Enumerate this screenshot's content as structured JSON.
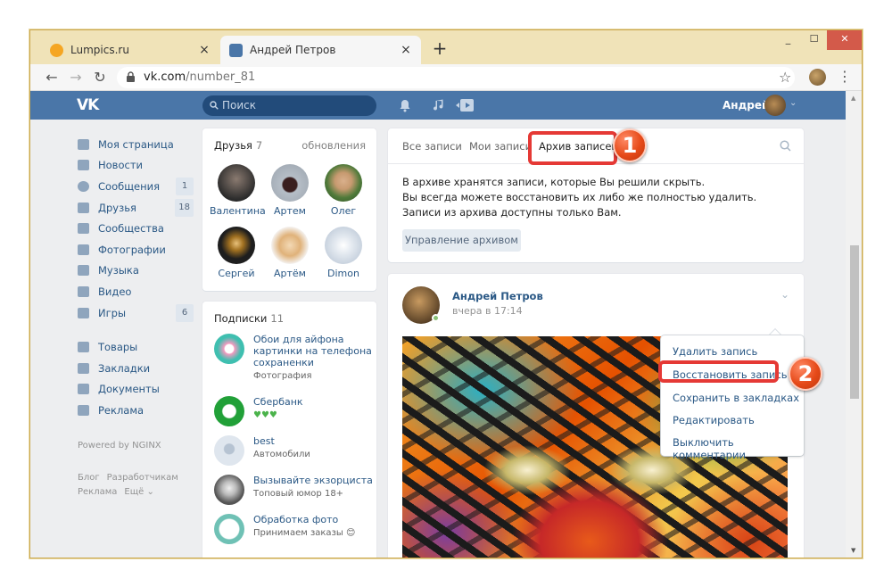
{
  "browser": {
    "tabs": [
      {
        "title": "Lumpics.ru",
        "fav_color": "#f5a623"
      },
      {
        "title": "Андрей Петров",
        "fav_color": "#4a76a8"
      }
    ],
    "tab_close": "×",
    "new_tab": "+",
    "url_host": "vk.com",
    "url_path": "/number_81",
    "win_min": "_",
    "win_max": "☐",
    "win_close": "✕"
  },
  "header": {
    "logo": "VK",
    "search_placeholder": "Поиск",
    "user_name": "Андрей"
  },
  "sidebar": {
    "items": [
      {
        "label": "Моя страница",
        "icon": "home-icon"
      },
      {
        "label": "Новости",
        "icon": "news-icon"
      },
      {
        "label": "Сообщения",
        "icon": "messages-icon",
        "count": "1"
      },
      {
        "label": "Друзья",
        "icon": "friends-icon",
        "count": "18"
      },
      {
        "label": "Сообщества",
        "icon": "groups-icon"
      },
      {
        "label": "Фотографии",
        "icon": "camera-icon"
      },
      {
        "label": "Музыка",
        "icon": "music-icon"
      },
      {
        "label": "Видео",
        "icon": "video-icon"
      },
      {
        "label": "Игры",
        "icon": "gamepad-icon",
        "count": "6"
      }
    ],
    "items2": [
      {
        "label": "Товары",
        "icon": "bag-icon"
      },
      {
        "label": "Закладки",
        "icon": "star-icon"
      },
      {
        "label": "Документы",
        "icon": "document-icon"
      },
      {
        "label": "Реклама",
        "icon": "megaphone-icon"
      }
    ],
    "powered": "Powered by NGINX",
    "footer": [
      "Блог",
      "Разработчикам",
      "Реклама",
      "Ещё ⌄"
    ]
  },
  "friends": {
    "title": "Друзья",
    "count": "7",
    "updates": "обновления",
    "list": [
      {
        "name": "Валентина",
        "color": "#3b3b3b"
      },
      {
        "name": "Артем",
        "color": "#9aa3ad"
      },
      {
        "name": "Олег",
        "color": "#6d8f55"
      },
      {
        "name": "Сергей",
        "color": "#2a2a2a"
      },
      {
        "name": "Артём",
        "color": "#e0b27a"
      },
      {
        "name": "Dimon",
        "color": "#c9d3df"
      }
    ]
  },
  "subscriptions": {
    "title": "Подписки",
    "count": "11",
    "list": [
      {
        "title": "Обои для айфона картинки на телефона сохраненки",
        "sub": "Фотография",
        "color": "#3fbfb0"
      },
      {
        "title": "Сбербанк",
        "sub": "♥♥♥",
        "color": "#21a038"
      },
      {
        "title": "best",
        "sub": "Автомобили",
        "color": "#dfe6ee"
      },
      {
        "title": "Вызывайте экзорциста",
        "sub": "Топовый юмор 18+",
        "color": "#8d8d8d"
      },
      {
        "title": "Обработка фото",
        "sub": "Принимаем заказы 😊",
        "color": "#6fc1b5"
      }
    ]
  },
  "wall_tabs": {
    "all": "Все записи",
    "mine": "Мои записи",
    "archive": "Архив записей",
    "badge1": "1"
  },
  "archive_info": {
    "line1": "В архиве хранятся записи, которые Вы решили скрыть.",
    "line2": "Вы всегда можете восстановить их либо же полностью удалить.",
    "line3": "Записи из архива доступны только Вам.",
    "manage_btn": "Управление архивом"
  },
  "post": {
    "author": "Андрей Петров",
    "date": "вчера в 17:14"
  },
  "post_menu": {
    "items": [
      "Удалить запись",
      "Восстановить запись",
      "Сохранить в закладках",
      "Редактировать",
      "Выключить комментарии"
    ],
    "badge2": "2"
  }
}
